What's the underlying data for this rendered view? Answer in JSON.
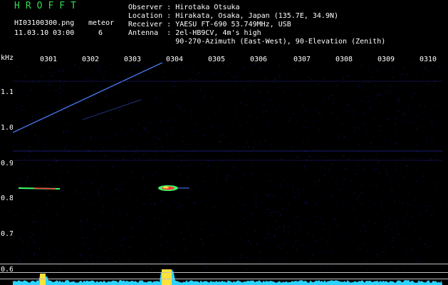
{
  "header": {
    "logo": "HROFFT",
    "filename": "HI03100300.png",
    "meteor_label": "meteor",
    "meteor_count": "6",
    "datetime": "11.03.10 03:00",
    "observer": "Observer : Hirotaka Otsuka",
    "location": "Location : Hirakata, Osaka, Japan (135.7E, 34.9N)",
    "receiver": "Receiver : YAESU FT-690 53.749MHz, USB",
    "antenna": "Antenna  : 2el-HB9CV, 4m's high",
    "antenna2": "           90-270-Azimuth (East-West), 90-Elevation (Zenith)"
  },
  "axis": {
    "unit": "kHz",
    "y_ticks": [
      "1.1",
      "1.0",
      "0.9",
      "0.8",
      "0.7",
      "0.6"
    ],
    "x_ticks": [
      "0301",
      "0302",
      "0303",
      "0304",
      "0305",
      "0306",
      "0307",
      "0308",
      "0309",
      "0310"
    ]
  },
  "colors": {
    "background": "#000000",
    "noise": "#1a1a8c",
    "signal": "#5080ff",
    "meteor_hot": "#ff3b3b",
    "meteor_warm": "#ffe23a",
    "meteor_cool": "#3cff6a",
    "baseline": "#2ad4ff",
    "logo": "#2fdc4a"
  }
}
